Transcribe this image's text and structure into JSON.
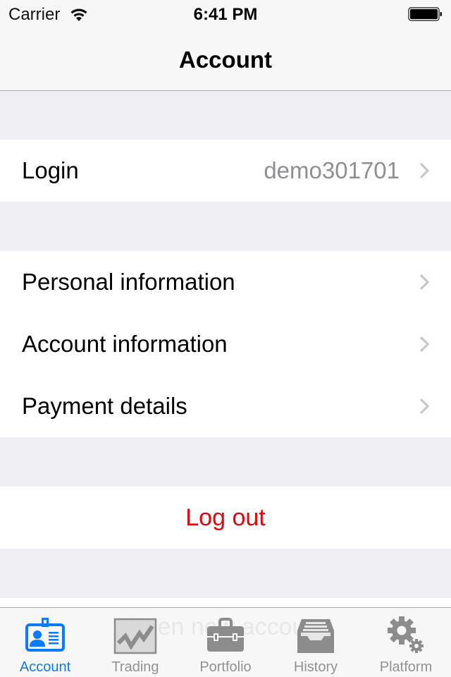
{
  "status_bar": {
    "carrier": "Carrier",
    "wifi_icon": "wifi-icon",
    "time": "6:41 PM",
    "battery_icon": "battery-full-icon"
  },
  "nav": {
    "title": "Account"
  },
  "sections": {
    "login": {
      "label": "Login",
      "value": "demo301701"
    },
    "info": [
      {
        "label": "Personal information"
      },
      {
        "label": "Account information"
      },
      {
        "label": "Payment details"
      }
    ],
    "logout": {
      "label": "Log out"
    },
    "partially_hidden": {
      "label": "Open new account"
    }
  },
  "tab_bar": {
    "active_index": 0,
    "tabs": [
      {
        "label": "Account",
        "icon": "id-badge-icon"
      },
      {
        "label": "Trading",
        "icon": "chart-icon"
      },
      {
        "label": "Portfolio",
        "icon": "briefcase-icon"
      },
      {
        "label": "History",
        "icon": "file-tray-icon"
      },
      {
        "label": "Platform",
        "icon": "gears-icon"
      }
    ]
  },
  "colors": {
    "accent": "#0a7aff",
    "destructive": "#e0070e",
    "group_background": "#efeff4",
    "secondary_text": "#8e8e93",
    "inactive_tab": "#929292"
  }
}
